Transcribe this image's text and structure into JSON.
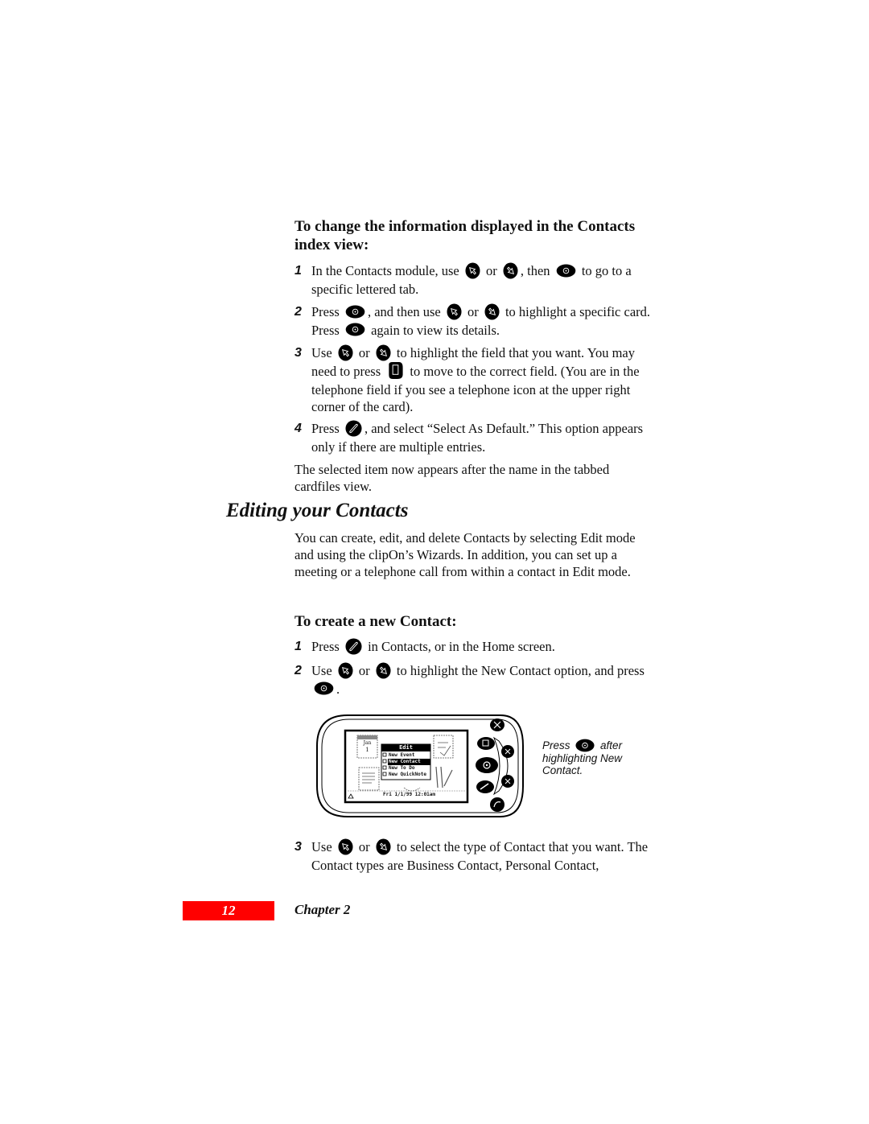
{
  "proc1": {
    "heading": "To change the information displayed in the Contacts index view:",
    "steps": [
      {
        "num": "1",
        "parts": [
          "In the Contacts module, use",
          "or",
          ", then",
          "to go to a specific lettered tab."
        ]
      },
      {
        "num": "2",
        "parts": [
          "Press",
          ", and then use",
          "or",
          "to highlight a specific card. Press",
          "again to view its details."
        ]
      },
      {
        "num": "3",
        "parts": [
          "Use",
          "or",
          "to highlight the field that you want. You may need to press",
          "to move to the correct field. (You are in the telephone field if you see a telephone icon at the upper right corner of the card)."
        ]
      },
      {
        "num": "4",
        "parts": [
          "Press",
          ", and select “Select As Default.” This option appears only if there are multiple entries."
        ]
      }
    ],
    "note": "The selected item now appears after the name in the tabbed cardfiles view."
  },
  "section": {
    "title": "Editing your Contacts",
    "intro": "You can create, edit, and delete Contacts by selecting Edit mode and using the clipOn’s Wizards. In addition, you can set up a meeting or a telephone call from within a contact in Edit mode."
  },
  "proc2": {
    "heading": "To create a new Contact:",
    "steps": [
      {
        "num": "1",
        "parts": [
          "Press",
          "in Contacts, or in the Home screen."
        ]
      },
      {
        "num": "2",
        "parts": [
          "Use",
          "or",
          "to highlight the New Contact option, and press",
          "."
        ]
      },
      {
        "num": "3",
        "parts": [
          "Use",
          "or",
          "to select the type of Contact that you want. The Contact types are Business Contact, Personal Contact,"
        ]
      }
    ]
  },
  "device": {
    "menu_title": "Edit",
    "menu_items": [
      "New Event",
      "New Contact",
      "New To Do",
      "New QuickNote"
    ],
    "selected_item": "New Contact",
    "status_bar": "Fri 1/1/99 12:01am",
    "calendar_month": "Jan",
    "calendar_day": "1"
  },
  "caption": {
    "press": "Press",
    "rest": "after highlighting New Contact."
  },
  "footer": {
    "page_number": "12",
    "chapter": "Chapter 2",
    "accent_color": "#ff0000"
  }
}
